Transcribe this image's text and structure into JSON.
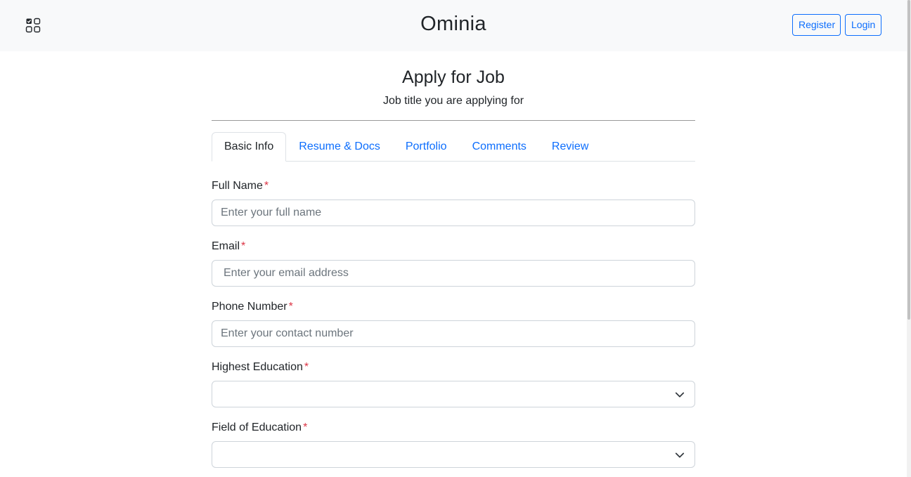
{
  "navbar": {
    "brand": "Ominia",
    "apps_icon": "apps-grid-icon",
    "register_label": "Register",
    "login_label": "Login"
  },
  "page": {
    "title": "Apply for Job",
    "subtitle": "Job title you are applying for"
  },
  "tabs": [
    {
      "label": "Basic Info",
      "active": true
    },
    {
      "label": "Resume & Docs",
      "active": false
    },
    {
      "label": "Portfolio",
      "active": false
    },
    {
      "label": "Comments",
      "active": false
    },
    {
      "label": "Review",
      "active": false
    }
  ],
  "form": {
    "required_mark": "*",
    "full_name": {
      "label": "Full Name",
      "placeholder": "Enter your full name",
      "value": ""
    },
    "email": {
      "label": "Email",
      "placeholder": "Enter your email address",
      "value": ""
    },
    "phone": {
      "label": "Phone Number",
      "placeholder": "Enter your contact number",
      "value": ""
    },
    "education": {
      "label": "Highest Education",
      "selected": ""
    },
    "field_of_education": {
      "label": "Field of Education",
      "selected": ""
    }
  },
  "colors": {
    "accent": "#0d6efd",
    "required": "#dc3545",
    "navbar_bg": "#f8f9fa"
  }
}
